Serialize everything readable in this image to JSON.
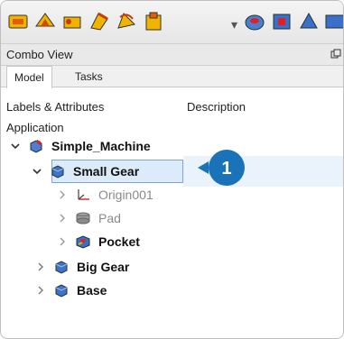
{
  "combo_view": {
    "title": "Combo View"
  },
  "tabs": [
    {
      "label": "Model",
      "active": true
    },
    {
      "label": "Tasks",
      "active": false
    }
  ],
  "tree": {
    "columns": {
      "labels": "Labels & Attributes",
      "description": "Description"
    },
    "section": "Application",
    "nodes": [
      {
        "label": "Simple_Machine",
        "bold": true,
        "expanded": true
      },
      {
        "label": "Small Gear",
        "bold": true,
        "expanded": true,
        "selected": true
      },
      {
        "label": "Origin001",
        "gray": true
      },
      {
        "label": "Pad",
        "gray": true
      },
      {
        "label": "Pocket",
        "bold": true
      },
      {
        "label": "Big Gear",
        "bold": true
      },
      {
        "label": "Base",
        "bold": true
      }
    ]
  },
  "callout": {
    "number": "1",
    "color": "#1a73b8"
  },
  "colors": {
    "selection_bg": "#dcebfa",
    "selection_border": "#7aa7d6"
  }
}
